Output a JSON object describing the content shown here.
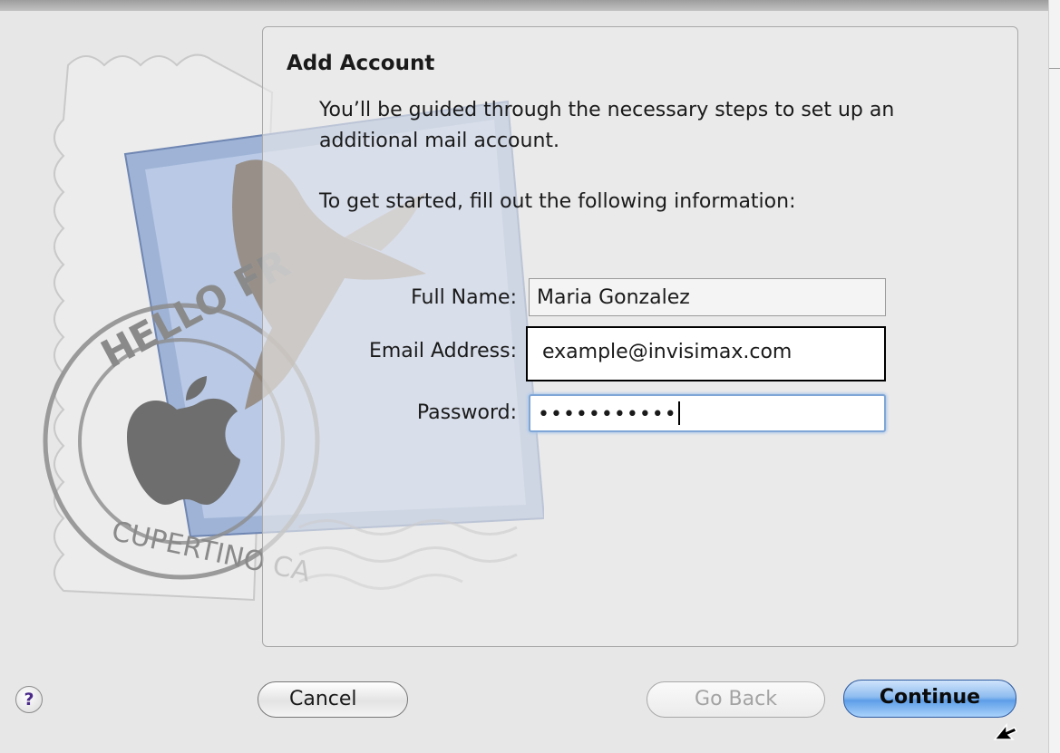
{
  "panel": {
    "title": "Add Account",
    "intro": "You’ll be guided through the necessary steps to set up an additional mail account.",
    "instructions": "To get started, fill out the following information:"
  },
  "form": {
    "full_name_label": "Full Name:",
    "full_name_value": "Maria Gonzalez",
    "email_label": "Email Address:",
    "email_value": "example@invisimax.com",
    "password_label": "Password:",
    "password_value": "•••••••••••"
  },
  "buttons": {
    "help": "?",
    "cancel": "Cancel",
    "go_back": "Go Back",
    "continue": "Continue"
  },
  "stamp_art": {
    "arc_top": "HELLO FR",
    "arc_bottom": "CUPERTINO CA"
  },
  "colors": {
    "accent": "#5d9ee8",
    "focus_ring": "#7fa6d6",
    "window_bg": "#e7e7e7"
  }
}
